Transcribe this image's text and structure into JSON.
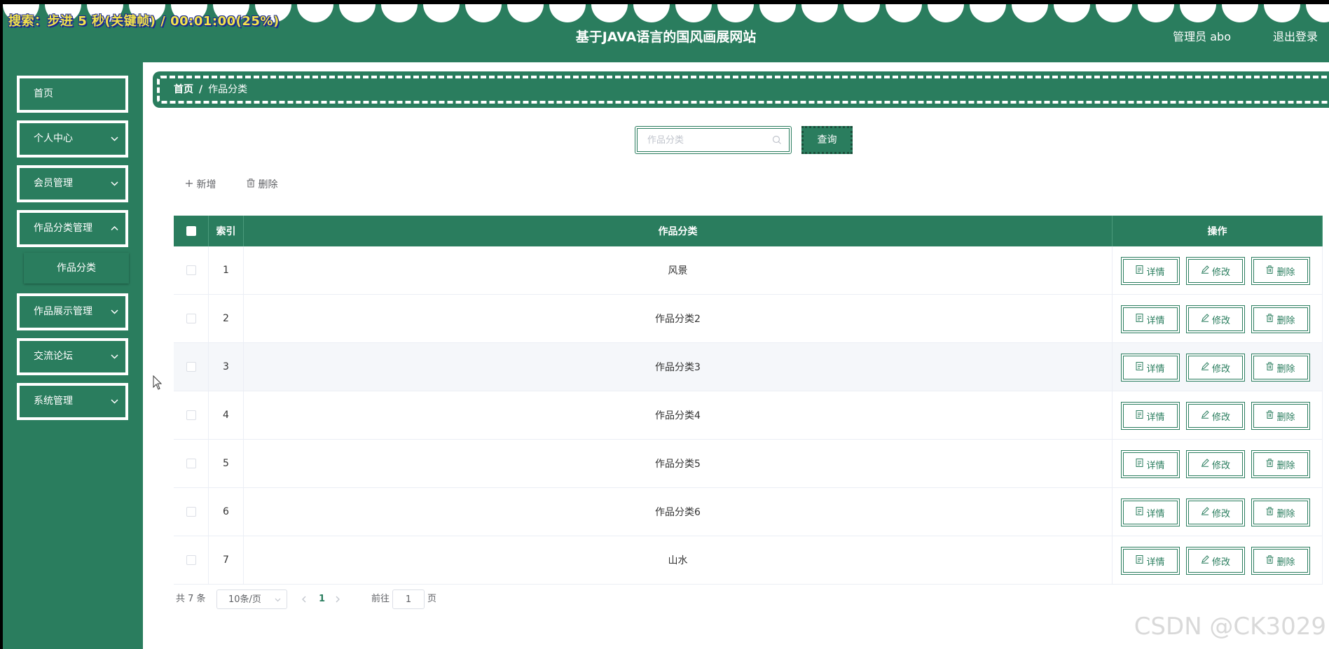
{
  "recorder": {
    "text": "搜索：步进 5 秒(关键帧) / 00:01:00(25%)"
  },
  "header": {
    "title": "基于JAVA语言的国风画展网站",
    "user_label": "管理员 abo",
    "logout_label": "退出登录"
  },
  "sidebar": {
    "items": [
      {
        "label": "首页"
      },
      {
        "label": "个人中心"
      },
      {
        "label": "会员管理"
      },
      {
        "label": "作品分类管理"
      },
      {
        "label": "作品展示管理"
      },
      {
        "label": "交流论坛"
      },
      {
        "label": "系统管理"
      }
    ],
    "submenu": {
      "label": "作品分类"
    }
  },
  "breadcrumb": {
    "home": "首页",
    "separator": "/",
    "current": "作品分类"
  },
  "search": {
    "placeholder": "作品分类",
    "value": "",
    "button_label": "查询"
  },
  "actions": {
    "add_label": "新增",
    "delete_label": "删除"
  },
  "table": {
    "headers": {
      "index": "索引",
      "name": "作品分类",
      "ops": "操作"
    },
    "rows": [
      {
        "index": "1",
        "name": "风景"
      },
      {
        "index": "2",
        "name": "作品分类2"
      },
      {
        "index": "3",
        "name": "作品分类3"
      },
      {
        "index": "4",
        "name": "作品分类4"
      },
      {
        "index": "5",
        "name": "作品分类5"
      },
      {
        "index": "6",
        "name": "作品分类6"
      },
      {
        "index": "7",
        "name": "山水"
      }
    ],
    "row_buttons": {
      "detail": "详情",
      "edit": "修改",
      "delete": "删除"
    }
  },
  "pagination": {
    "total": "共 7 条",
    "page_size": "10条/页",
    "current_page": "1",
    "goto_prefix": "前往",
    "goto_value": "1",
    "goto_suffix": "页"
  },
  "watermark": "CSDN @CK3029",
  "colors": {
    "primary": "#2a7d5e",
    "text_muted": "#606266",
    "border": "#ebeef5"
  }
}
